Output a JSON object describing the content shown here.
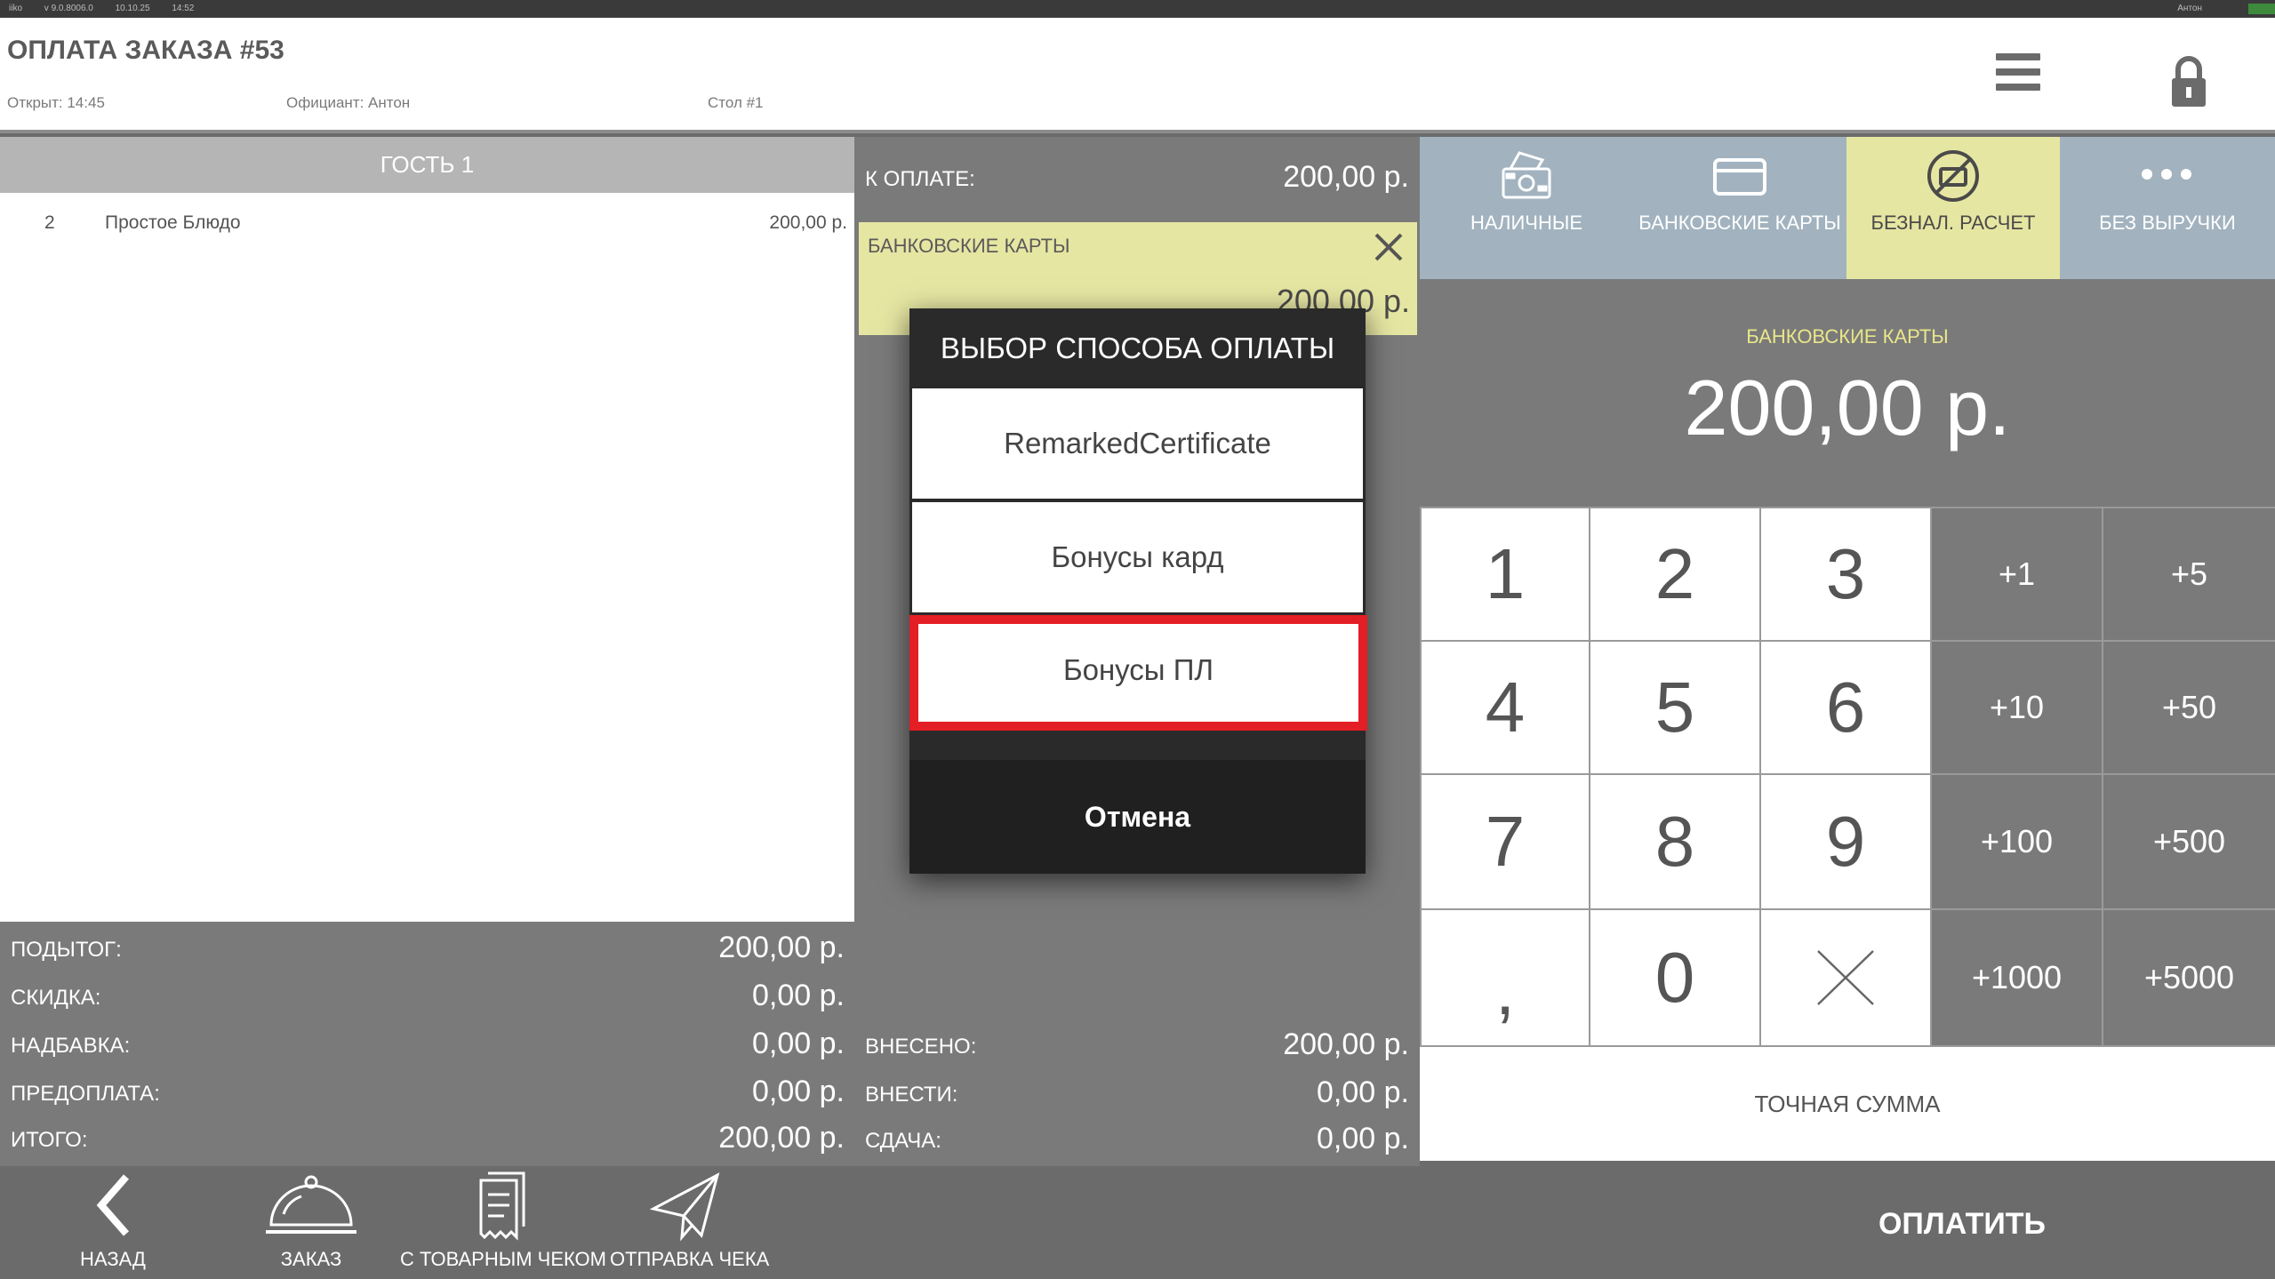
{
  "status_bar": {
    "left_items": [
      "iiko",
      "v 9.0.8006.0",
      "10.10.25",
      "14:52"
    ],
    "user": "Антон"
  },
  "header": {
    "title": "ОПЛАТА ЗАКАЗА #53",
    "opened": "Открыт: 14:45",
    "waiter": "Официант: Антон",
    "table": "Стол #1"
  },
  "guest": {
    "label": "ГОСТЬ 1",
    "items": [
      {
        "qty": "2",
        "name": "Простое Блюдо",
        "price": "200,00 р."
      }
    ]
  },
  "totals": [
    {
      "label": "ПОДЫТОГ:",
      "value": "200,00 р."
    },
    {
      "label": "СКИДКА:",
      "value": "0,00 р."
    },
    {
      "label": "НАДБАВКА:",
      "value": "0,00 р."
    },
    {
      "label": "ПРЕДОПЛАТА:",
      "value": "0,00 р."
    },
    {
      "label": "ИТОГО:",
      "value": "200,00 р."
    }
  ],
  "payment": {
    "due_label": "К ОПЛАТЕ:",
    "due_value": "200,00 р.",
    "card_label": "БАНКОВСКИЕ КАРТЫ",
    "card_value": "200,00 р.",
    "paid_label": "ВНЕСЕНО:",
    "paid_value": "200,00 р.",
    "to_pay_label": "ВНЕСТИ:",
    "to_pay_value": "0,00 р.",
    "change_label": "СДАЧА:",
    "change_value": "0,00 р."
  },
  "modal": {
    "title": "ВЫБОР СПОСОБА ОПЛАТЫ",
    "options": [
      "RemarkedCertificate",
      "Бонусы кард",
      "Бонусы ПЛ"
    ],
    "selected_index": 2,
    "cancel": "Отмена"
  },
  "tabs": [
    {
      "label": "НАЛИЧНЫЕ",
      "icon": "cash-register-icon"
    },
    {
      "label": "БАНКОВСКИЕ КАРТЫ",
      "icon": "credit-card-icon"
    },
    {
      "label": "БЕЗНАЛ. РАСЧЕТ",
      "icon": "no-cash-icon",
      "active": true
    },
    {
      "label": "БЕЗ ВЫРУЧКИ",
      "icon": "more-dots-icon"
    }
  ],
  "display": {
    "label": "БАНКОВСКИЕ КАРТЫ",
    "value": "200,00 р."
  },
  "keypad": {
    "digits": [
      "1",
      "2",
      "3",
      "4",
      "5",
      "6",
      "7",
      "8",
      "9",
      ",",
      "0"
    ],
    "increments": [
      "+1",
      "+5",
      "+10",
      "+50",
      "+100",
      "+500",
      "+1000",
      "+5000"
    ]
  },
  "exact_sum": "ТОЧНАЯ СУММА",
  "bottom_nav": [
    {
      "label": "НАЗАД",
      "icon": "back-chevron-icon"
    },
    {
      "label": "ЗАКАЗ",
      "icon": "cloche-icon"
    },
    {
      "label": "С ТОВАРНЫМ ЧЕКОМ",
      "icon": "receipt-icon"
    },
    {
      "label": "ОТПРАВКА ЧЕКА",
      "icon": "send-plane-icon"
    }
  ],
  "pay_button": "ОПЛАТИТЬ",
  "colors": {
    "accent_yellow": "#e6e6a3",
    "tab_blue": "#a2b3bf",
    "selected_red": "#e31e24",
    "panel_gray": "#7a7a7a"
  }
}
